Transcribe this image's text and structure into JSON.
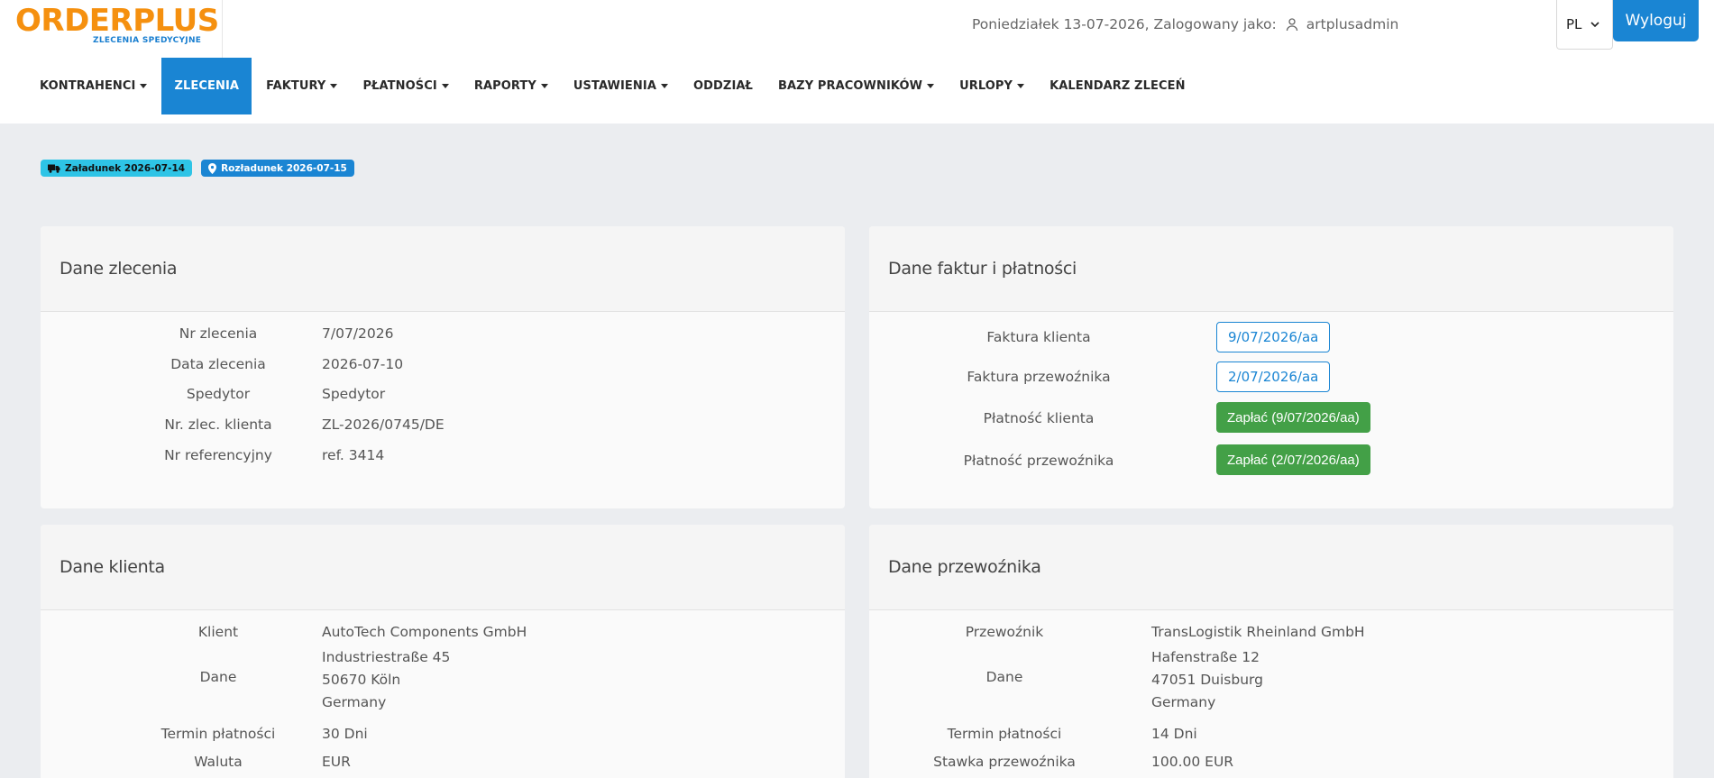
{
  "logo": {
    "main": "ORDERPLUS",
    "sub": "ZLECENIA SPEDYCYJNE"
  },
  "top_info": {
    "text": "Poniedziałek 13-07-2026, Zalogowany jako:",
    "user": "artplusadmin"
  },
  "lang": {
    "value": "PL"
  },
  "logout_label": "Wyloguj",
  "nav": [
    {
      "label": "KONTRAHENCI",
      "dropdown": true
    },
    {
      "label": "ZLECENIA",
      "dropdown": false,
      "active": true
    },
    {
      "label": "FAKTURY",
      "dropdown": true
    },
    {
      "label": "PŁATNOŚCI",
      "dropdown": true
    },
    {
      "label": "RAPORTY",
      "dropdown": true
    },
    {
      "label": "USTAWIENIA",
      "dropdown": true
    },
    {
      "label": "ODDZIAŁ",
      "dropdown": false
    },
    {
      "label": "BAZY PRACOWNIKÓW",
      "dropdown": true
    },
    {
      "label": "URLOPY",
      "dropdown": true
    },
    {
      "label": "KALENDARZ ZLECEŃ",
      "dropdown": false
    }
  ],
  "badges": {
    "load": "Załadunek 2026-07-14",
    "unload": "Rozładunek 2026-07-15"
  },
  "order_card": {
    "title": "Dane zlecenia",
    "rows": [
      {
        "label": "Nr zlecenia",
        "value": "7/07/2026"
      },
      {
        "label": "Data zlecenia",
        "value": "2026-07-10"
      },
      {
        "label": "Spedytor",
        "value": "Spedytor"
      },
      {
        "label": "Nr. zlec. klienta",
        "value": "ZL-2026/0745/DE"
      },
      {
        "label": "Nr referencyjny",
        "value": "ref. 3414"
      }
    ]
  },
  "invoice_card": {
    "title": "Dane faktur i płatności",
    "rows": [
      {
        "label": "Faktura klienta",
        "value": "9/07/2026/aa"
      },
      {
        "label": "Faktura przewoźnika",
        "value": "2/07/2026/aa"
      },
      {
        "label": "Płatność klienta",
        "value": "Zapłać (9/07/2026/aa)"
      },
      {
        "label": "Płatność przewoźnika",
        "value": "Zapłać (2/07/2026/aa)"
      }
    ]
  },
  "client_card": {
    "title": "Dane klienta",
    "client_label": "Klient",
    "client_value": "AutoTech Components GmbH",
    "data_label": "Dane",
    "address": [
      "Industriestraße 45",
      "50670 Köln",
      "Germany"
    ],
    "term_label": "Termin płatności",
    "term_value": "30 Dni",
    "currency_label": "Waluta",
    "currency_value": "EUR"
  },
  "carrier_card": {
    "title": "Dane przewoźnika",
    "carrier_label": "Przewoźnik",
    "carrier_value": "TransLogistik Rheinland GmbH",
    "data_label": "Dane",
    "address": [
      "Hafenstraße 12",
      "47051 Duisburg",
      "Germany"
    ],
    "term_label": "Termin płatności",
    "term_value": "14 Dni",
    "rate_label": "Stawka przewoźnika",
    "rate_value": "100.00 EUR"
  },
  "colors": {
    "accent": "#1a85d3",
    "logo_orange": "#f5900f",
    "success": "#43a047",
    "badge_cyan": "#2ec4e6"
  }
}
